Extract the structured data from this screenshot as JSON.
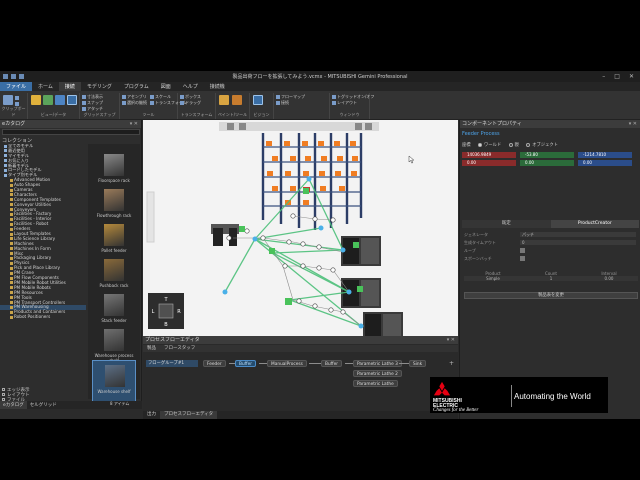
{
  "titlebar": {
    "title": "製品出荷フローを拡張してみよう.vcmx - MITSUBISHI Gemini Professional",
    "minimize": "–",
    "maximize": "□",
    "close": "✕"
  },
  "ribbon_tabs": [
    "ファイル",
    "ホーム",
    "接続",
    "モデリング",
    "プログラム",
    "図面",
    "ヘルプ",
    "接続機"
  ],
  "ribbon": {
    "groups": [
      "クリップボード",
      "ビュー/データ",
      "グリッドスナップ",
      "ツール",
      "トランスフォーム",
      "ペイント/ツール",
      "ビジョン",
      "ウィンドウ"
    ],
    "small": [
      "切り取り",
      "コピー",
      "貼り付け",
      "選択",
      "移動",
      "回転",
      "インタラクト",
      "寸法表示",
      "スナップ",
      "アタッチ",
      "アセンブリ",
      "選択の継続",
      "スケール",
      "トランスフォーム",
      "ボックス",
      "ドラッグ",
      "フォーカス",
      "フローマップ",
      "接続",
      "トグリッドオン/オフ",
      "レイアウト"
    ]
  },
  "left": {
    "header": "eカタログ",
    "collections_label": "コレクション",
    "tree": [
      {
        "label": "全てのモデル",
        "indent": 0
      },
      {
        "label": "最近使用",
        "indent": 0
      },
      {
        "label": "マイモデル",
        "indent": 0
      },
      {
        "label": "お気に入り",
        "indent": 0
      },
      {
        "label": "新着モデル",
        "indent": 0
      },
      {
        "label": "ロードしたモデル",
        "indent": 0
      },
      {
        "label": "タイプ別モデル",
        "indent": 0
      },
      {
        "label": "Advanced Motion",
        "indent": 1
      },
      {
        "label": "Auto Shapes",
        "indent": 1
      },
      {
        "label": "Cameras",
        "indent": 1
      },
      {
        "label": "Characters",
        "indent": 1
      },
      {
        "label": "Component Templates",
        "indent": 1
      },
      {
        "label": "Conveyor Utilities",
        "indent": 1
      },
      {
        "label": "Conveyors",
        "indent": 1
      },
      {
        "label": "Facilities - Factory",
        "indent": 1
      },
      {
        "label": "Facilities - Interior",
        "indent": 1
      },
      {
        "label": "Facilities - Robot",
        "indent": 1
      },
      {
        "label": "Feeders",
        "indent": 1
      },
      {
        "label": "Layout Templates",
        "indent": 1
      },
      {
        "label": "Life Science Library",
        "indent": 1
      },
      {
        "label": "Machines",
        "indent": 1
      },
      {
        "label": "Machines In Form",
        "indent": 1
      },
      {
        "label": "Misc",
        "indent": 1
      },
      {
        "label": "Packaging Library",
        "indent": 1
      },
      {
        "label": "Physics",
        "indent": 1
      },
      {
        "label": "Pick and Place Library",
        "indent": 1
      },
      {
        "label": "PM Crane",
        "indent": 1
      },
      {
        "label": "PM Flow Components",
        "indent": 1
      },
      {
        "label": "PM Mobile Robot Utilities",
        "indent": 1
      },
      {
        "label": "PM Mobile Robots",
        "indent": 1
      },
      {
        "label": "PM Resources",
        "indent": 1
      },
      {
        "label": "PM Tools",
        "indent": 1
      },
      {
        "label": "PM Transport Controllers",
        "indent": 1
      },
      {
        "label": "PM Warehousing",
        "indent": 1,
        "selected": true
      },
      {
        "label": "Products and Containers",
        "indent": 1
      },
      {
        "label": "Robot Positioners",
        "indent": 1
      }
    ],
    "tiles": [
      {
        "label": "Floorspace rack"
      },
      {
        "label": "Flowthrough rack"
      },
      {
        "label": "Pallet feeder"
      },
      {
        "label": "Pushback rack"
      },
      {
        "label": "Stack feeder"
      },
      {
        "label": "Warehouse process shelf"
      },
      {
        "label": "Warehouse shelf",
        "selected": true
      }
    ],
    "options": [
      "エッジ表示",
      "レイアウト",
      "ファイル"
    ],
    "tiles_footer": "8 アイテム",
    "tabs": [
      "eカタログ",
      "セルグリッド"
    ]
  },
  "process": {
    "header": "プロセスフローエディタ",
    "tabs": [
      "製品",
      "フロースタッフ"
    ],
    "row_label": "フローグループ#1",
    "nodes": [
      "Feeder",
      "Buffer",
      "ManualProcess",
      "Buffer",
      "Parametric Lathe 3",
      "Sink",
      "Parametric Lathe 2",
      "Parametric Lathe"
    ],
    "bottom_tabs": [
      "出力",
      "プロセスフローエディタ"
    ]
  },
  "right": {
    "header": "コンポーネントプロパティ",
    "component_name": "Feeder Process",
    "coord_label": "座標",
    "radios": [
      "ワールド",
      "親",
      "オブジェクト"
    ],
    "coords": [
      "14036.9849",
      "-53.80",
      "-1214.7810"
    ],
    "rot": [
      "0.00",
      "0.00",
      "0.00"
    ],
    "tabs": [
      "既定",
      "ProductCreator"
    ],
    "props": [
      {
        "label": "ジェネレータ",
        "value": "パッチ"
      },
      {
        "label": "生成タイムアウト",
        "value": "0"
      },
      {
        "label": "ループ",
        "value": ""
      },
      {
        "label": "スポーンバッチ",
        "value": ""
      }
    ],
    "table_headers": [
      "Product",
      "Count",
      "Interval"
    ],
    "table_row": [
      "Simple",
      "1",
      "0.00"
    ],
    "button": "製品表を変更"
  },
  "logo": {
    "brand_line1": "MITSUBISHI",
    "brand_line2": "ELECTRIC",
    "tagline": "Changes for the Better",
    "slogan": "Automating the World"
  },
  "colors": {
    "accent": "#3a6ea5",
    "rack_frame": "#2c3d66",
    "box": "#f07d22",
    "flow_line": "#4cc07a",
    "logo_red": "#e60012"
  }
}
